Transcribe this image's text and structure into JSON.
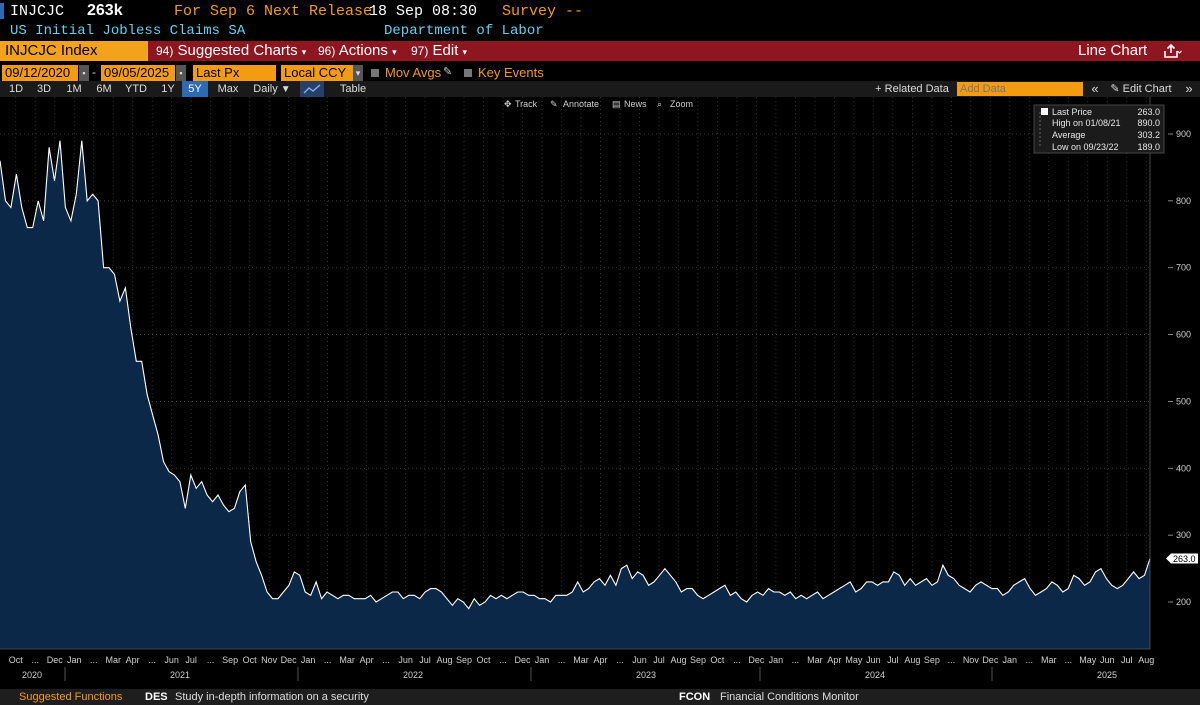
{
  "header": {
    "ticker": "INJCJC",
    "value": "263k",
    "for_label": "For Sep 6",
    "next_release_label": "Next Release",
    "next_release_value": "18 Sep 08:30",
    "survey_label": "Survey --",
    "description": "US Initial Jobless Claims SA",
    "source": "Department of Labor"
  },
  "menubar": {
    "index_label": "INJCJC Index",
    "suggested_num": "94)",
    "suggested_label": "Suggested Charts",
    "actions_num": "96)",
    "actions_label": "Actions",
    "edit_num": "97)",
    "edit_label": "Edit",
    "chart_type": "Line Chart"
  },
  "controls": {
    "start_date": "09/12/2020",
    "end_date": "09/05/2025",
    "field": "Last Px",
    "currency": "Local CCY",
    "mov_avgs": "Mov Avgs",
    "key_events": "Key Events"
  },
  "tabs": {
    "items": [
      "1D",
      "3D",
      "1M",
      "6M",
      "YTD",
      "1Y",
      "5Y",
      "Max"
    ],
    "active": "5Y",
    "period": "Daily",
    "table": "Table",
    "related": "+ Related Data",
    "add_data_placeholder": "Add Data",
    "edit_chart": "Edit Chart"
  },
  "chart_tools": {
    "track": "Track",
    "annotate": "Annotate",
    "news": "News",
    "zoom": "Zoom"
  },
  "legend": {
    "last_price_label": "Last Price",
    "last_price_value": "263.0",
    "high_label": "High on 01/08/21",
    "high_value": "890.0",
    "average_label": "Average",
    "average_value": "303.2",
    "low_label": "Low on 09/23/22",
    "low_value": "189.0"
  },
  "last_marker": "263.0",
  "bottombar": {
    "suggested_functions": "Suggested Functions",
    "des_code": "DES",
    "des_desc": "Study in-depth information on a security",
    "fcon_code": "FCON",
    "fcon_desc": "Financial Conditions Monitor"
  },
  "colors": {
    "amber": "#f39c12",
    "menu_red": "#8e1620",
    "area_fill": "#0b2848",
    "line": "#ffffff"
  },
  "chart_data": {
    "type": "area",
    "title": "",
    "xlabel": "",
    "ylabel": "",
    "ylim": [
      100,
      950
    ],
    "yticks": [
      200,
      300,
      400,
      500,
      600,
      700,
      800,
      900
    ],
    "x_labels": [
      "Oct",
      "...",
      "Dec",
      "Jan",
      "...",
      "Mar",
      "Apr",
      "...",
      "Jun",
      "Jul",
      "...",
      "Sep",
      "Oct",
      "Nov",
      "Dec",
      "Jan",
      "...",
      "Mar",
      "Apr",
      "...",
      "Jun",
      "Jul",
      "Aug",
      "Sep",
      "Oct",
      "...",
      "Dec",
      "Jan",
      "...",
      "Mar",
      "Apr",
      "...",
      "Jun",
      "Jul",
      "Aug",
      "Sep",
      "Oct",
      "...",
      "Dec",
      "Jan",
      "...",
      "Mar",
      "Apr",
      "May",
      "Jun",
      "Jul",
      "Aug",
      "Sep",
      "...",
      "Nov",
      "Dec",
      "Jan",
      "...",
      "Mar",
      "...",
      "May",
      "Jun",
      "Jul",
      "Aug"
    ],
    "years": [
      "2020",
      "2021",
      "2022",
      "2023",
      "2024",
      "2025"
    ],
    "series": [
      {
        "values": [
          860,
          800,
          790,
          840,
          790,
          760,
          760,
          800,
          770,
          880,
          830,
          890,
          790,
          770,
          810,
          890,
          800,
          810,
          800,
          700,
          700,
          690,
          650,
          670,
          610,
          560,
          560,
          510,
          480,
          450,
          410,
          395,
          390,
          380,
          340,
          390,
          370,
          380,
          360,
          350,
          360,
          345,
          335,
          340,
          365,
          375,
          290,
          260,
          240,
          215,
          205,
          205,
          215,
          225,
          245,
          240,
          215,
          210,
          230,
          205,
          215,
          210,
          205,
          210,
          210,
          205,
          205,
          205,
          210,
          200,
          205,
          210,
          215,
          215,
          205,
          210,
          210,
          205,
          215,
          220,
          220,
          215,
          205,
          195,
          205,
          200,
          190,
          205,
          195,
          200,
          210,
          205,
          210,
          205,
          210,
          215,
          215,
          210,
          210,
          205,
          205,
          200,
          210,
          210,
          210,
          215,
          230,
          215,
          220,
          230,
          235,
          225,
          240,
          225,
          250,
          255,
          235,
          245,
          240,
          225,
          230,
          240,
          250,
          240,
          230,
          215,
          220,
          220,
          210,
          205,
          210,
          215,
          220,
          225,
          210,
          215,
          205,
          200,
          210,
          215,
          210,
          220,
          215,
          215,
          210,
          215,
          205,
          210,
          205,
          210,
          215,
          205,
          210,
          215,
          220,
          225,
          230,
          215,
          220,
          230,
          230,
          225,
          230,
          230,
          245,
          240,
          225,
          235,
          225,
          230,
          235,
          225,
          230,
          255,
          240,
          235,
          225,
          220,
          215,
          225,
          230,
          225,
          220,
          220,
          210,
          215,
          225,
          230,
          235,
          220,
          210,
          215,
          220,
          230,
          225,
          215,
          220,
          240,
          235,
          225,
          230,
          245,
          250,
          235,
          225,
          220,
          225,
          235,
          245,
          235,
          240,
          265
        ]
      }
    ]
  }
}
